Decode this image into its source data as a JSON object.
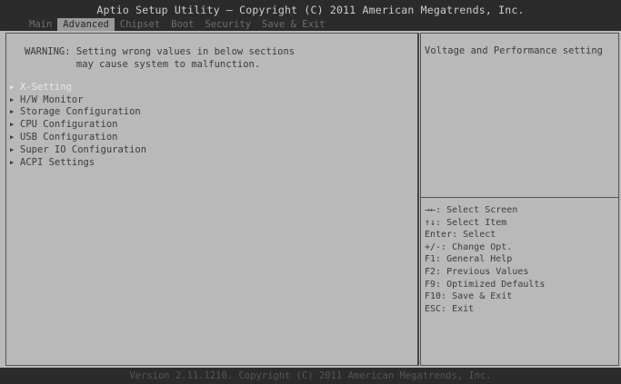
{
  "header": {
    "title": "Aptio Setup Utility – Copyright (C) 2011 American Megatrends, Inc.",
    "tabs": [
      {
        "label": "Main"
      },
      {
        "label": "Advanced"
      },
      {
        "label": "Chipset"
      },
      {
        "label": "Boot"
      },
      {
        "label": "Security"
      },
      {
        "label": "Save & Exit"
      }
    ]
  },
  "main": {
    "warning_line1": "WARNING: Setting wrong values in below sections",
    "warning_line2": "         may cause system to malfunction.",
    "items": [
      {
        "label": "X-Setting"
      },
      {
        "label": "H/W Monitor"
      },
      {
        "label": "Storage Configuration"
      },
      {
        "label": "CPU Configuration"
      },
      {
        "label": "USB Configuration"
      },
      {
        "label": "Super IO Configuration"
      },
      {
        "label": "ACPI Settings"
      }
    ],
    "selected_index": 0
  },
  "side": {
    "help_text": "Voltage and Performance setting",
    "keys": [
      "→←: Select Screen",
      "↑↓: Select Item",
      "Enter: Select",
      "+/-: Change Opt.",
      "F1: General Help",
      "F2: Previous Values",
      "F9: Optimized Defaults",
      "F10: Save & Exit",
      "ESC: Exit"
    ]
  },
  "footer": {
    "text": "Version 2.11.1210. Copyright (C) 2011 American Megatrends, Inc."
  }
}
